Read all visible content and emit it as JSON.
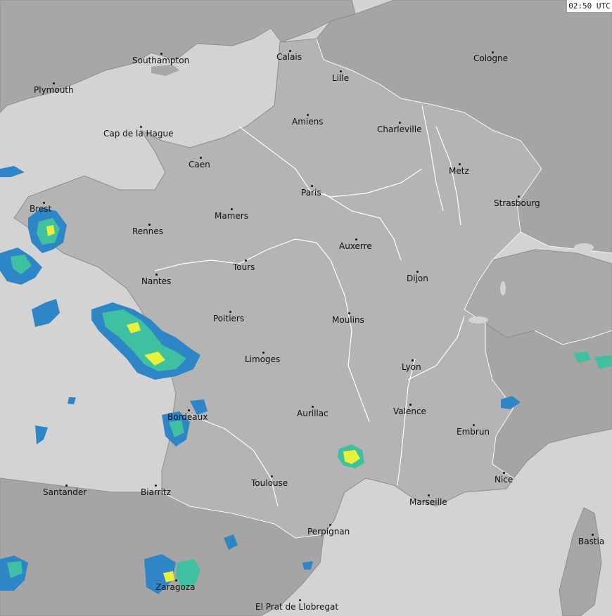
{
  "timestamp": "02:50 UTC",
  "colors": {
    "sea": "#d3d3d3",
    "france": "#b4b4b4",
    "neighbor": "#a5a5a5",
    "coast": "#8e8e8e",
    "river": "#ffffff",
    "rain_low": "#2f86c7",
    "rain_mid": "#3fc0a0",
    "rain_high": "#e7f03a"
  },
  "cities": [
    {
      "name": "Southampton"
    },
    {
      "name": "Calais"
    },
    {
      "name": "Cologne"
    },
    {
      "name": "Plymouth"
    },
    {
      "name": "Lille"
    },
    {
      "name": "Amiens"
    },
    {
      "name": "Charleville"
    },
    {
      "name": "Cap de la Hague"
    },
    {
      "name": "Caen"
    },
    {
      "name": "Metz"
    },
    {
      "name": "Paris"
    },
    {
      "name": "Strasbourg"
    },
    {
      "name": "Brest"
    },
    {
      "name": "Mamers"
    },
    {
      "name": "Rennes"
    },
    {
      "name": "Auxerre"
    },
    {
      "name": "Tours"
    },
    {
      "name": "Dijon"
    },
    {
      "name": "Nantes"
    },
    {
      "name": "Poitiers"
    },
    {
      "name": "Moulins"
    },
    {
      "name": "Limoges"
    },
    {
      "name": "Lyon"
    },
    {
      "name": "Bordeaux"
    },
    {
      "name": "Aurillac"
    },
    {
      "name": "Valence"
    },
    {
      "name": "Embrun"
    },
    {
      "name": "Nice"
    },
    {
      "name": "Toulouse"
    },
    {
      "name": "Santander"
    },
    {
      "name": "Biarritz"
    },
    {
      "name": "Marseille"
    },
    {
      "name": "Perpignan"
    },
    {
      "name": "Bastia"
    },
    {
      "name": "Zaragoza"
    },
    {
      "name": "El Prat de Llobregat"
    }
  ]
}
